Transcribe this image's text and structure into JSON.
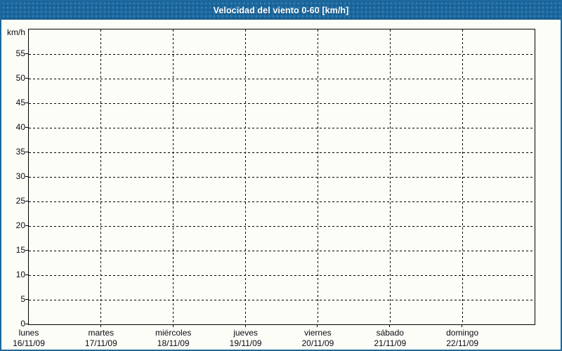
{
  "title_bar": {
    "title": "Velocidad del viento 0-60 [km/h]"
  },
  "chart_data": {
    "type": "line",
    "title": "Velocidad del viento 0-60 [km/h]",
    "ylabel": "km/h",
    "xlabel": "",
    "ylim": [
      0,
      60
    ],
    "y_ticks": [
      0,
      5,
      10,
      15,
      20,
      25,
      30,
      35,
      40,
      45,
      50,
      55
    ],
    "x_categories": [
      {
        "day": "lunes",
        "date": "16/11/09"
      },
      {
        "day": "martes",
        "date": "17/11/09"
      },
      {
        "day": "miércoles",
        "date": "18/11/09"
      },
      {
        "day": "jueves",
        "date": "19/11/09"
      },
      {
        "day": "viernes",
        "date": "20/11/09"
      },
      {
        "day": "sábado",
        "date": "21/11/09"
      },
      {
        "day": "domingo",
        "date": "22/11/09"
      }
    ],
    "series": [],
    "grid": true,
    "grid_style": "dashed",
    "legend_position": "none"
  },
  "colors": {
    "accent": "#1c689e",
    "background": "#fcfdf6",
    "grid": "#000000",
    "title_text": "#ffffff",
    "label_text": "#0a0a14"
  }
}
